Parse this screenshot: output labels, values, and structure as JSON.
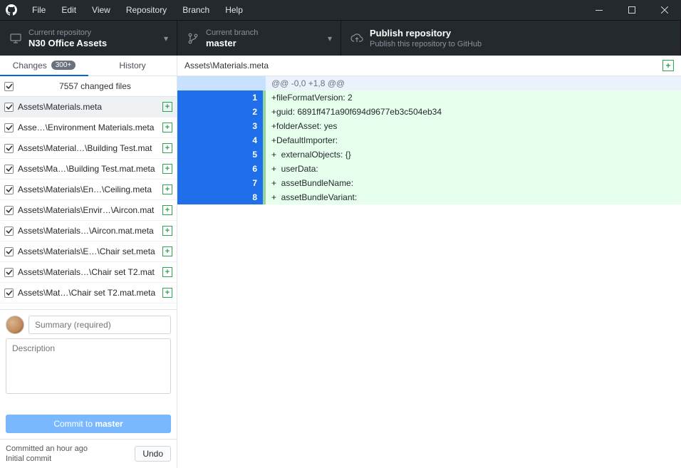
{
  "menu": {
    "items": [
      "File",
      "Edit",
      "View",
      "Repository",
      "Branch",
      "Help"
    ]
  },
  "toolbar": {
    "repo": {
      "label": "Current repository",
      "value": "N30 Office Assets"
    },
    "branch": {
      "label": "Current branch",
      "value": "master"
    },
    "publish": {
      "label": "Publish repository",
      "sub": "Publish this repository to GitHub"
    }
  },
  "tabs": {
    "changes": {
      "label": "Changes",
      "badge": "300+"
    },
    "history": {
      "label": "History"
    }
  },
  "filelist": {
    "count": "7557 changed files",
    "items": [
      {
        "path": "Assets\\Materials.meta",
        "selected": true
      },
      {
        "path": "Asse…\\Environment Materials.meta"
      },
      {
        "path": "Assets\\Material…\\Building Test.mat"
      },
      {
        "path": "Assets\\Ma…\\Building Test.mat.meta"
      },
      {
        "path": "Assets\\Materials\\En…\\Ceiling.meta"
      },
      {
        "path": "Assets\\Materials\\Envir…\\Aircon.mat"
      },
      {
        "path": "Assets\\Materials…\\Aircon.mat.meta"
      },
      {
        "path": "Assets\\Materials\\E…\\Chair set.meta"
      },
      {
        "path": "Assets\\Materials…\\Chair set T2.mat"
      },
      {
        "path": "Assets\\Mat…\\Chair set T2.mat.meta"
      }
    ]
  },
  "commit": {
    "summary_placeholder": "Summary (required)",
    "desc_placeholder": "Description",
    "button_prefix": "Commit to ",
    "button_branch": "master"
  },
  "undo": {
    "line1": "Committed an hour ago",
    "line2": "Initial commit",
    "button": "Undo"
  },
  "diff": {
    "path": "Assets\\Materials.meta",
    "hunk": "@@ -0,0 +1,8 @@",
    "lines": [
      {
        "n": "1",
        "text": "+fileFormatVersion: 2"
      },
      {
        "n": "2",
        "text": "+guid: 6891ff471a90f694d9677eb3c504eb34"
      },
      {
        "n": "3",
        "text": "+folderAsset: yes"
      },
      {
        "n": "4",
        "text": "+DefaultImporter:"
      },
      {
        "n": "5",
        "text": "+  externalObjects: {}"
      },
      {
        "n": "6",
        "text": "+  userData:"
      },
      {
        "n": "7",
        "text": "+  assetBundleName:"
      },
      {
        "n": "8",
        "text": "+  assetBundleVariant:"
      }
    ]
  }
}
